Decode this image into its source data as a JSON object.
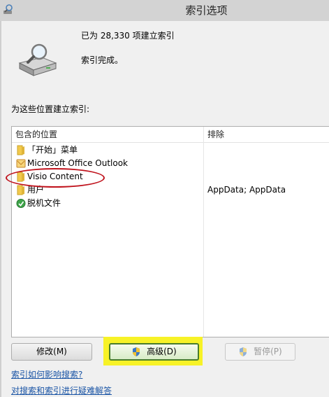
{
  "window": {
    "title": "索引选项",
    "title_icon": "indexing-options-icon"
  },
  "status": {
    "icon": "drive-magnifier-icon",
    "count_text": "已为 28,330 项建立索引",
    "complete_text": "索引完成。"
  },
  "locations_label": "为这些位置建立索引:",
  "list": {
    "headers": {
      "included": "包含的位置",
      "exclude": "排除"
    },
    "rows": [
      {
        "label": "「开始」菜单",
        "exclude": "",
        "icon": "folder-icon"
      },
      {
        "label": "Microsoft Office Outlook",
        "exclude": "",
        "icon": "outlook-icon"
      },
      {
        "label": "Visio Content",
        "exclude": "",
        "icon": "folder-icon"
      },
      {
        "label": "用户",
        "exclude": "AppData; AppData",
        "icon": "folder-icon"
      },
      {
        "label": "脱机文件",
        "exclude": "",
        "icon": "offline-files-icon"
      }
    ]
  },
  "buttons": {
    "modify": "修改(M)",
    "advanced": "高级(D)",
    "pause": "暂停(P)"
  },
  "links": {
    "how_indexing_affects_search": "索引如何影响搜索?",
    "troubleshoot": "对搜索和索引进行疑难解答"
  },
  "colors": {
    "highlight_ellipse": "#c0121c",
    "highlight_box": "#f7f227",
    "link": "#1c56a6"
  }
}
